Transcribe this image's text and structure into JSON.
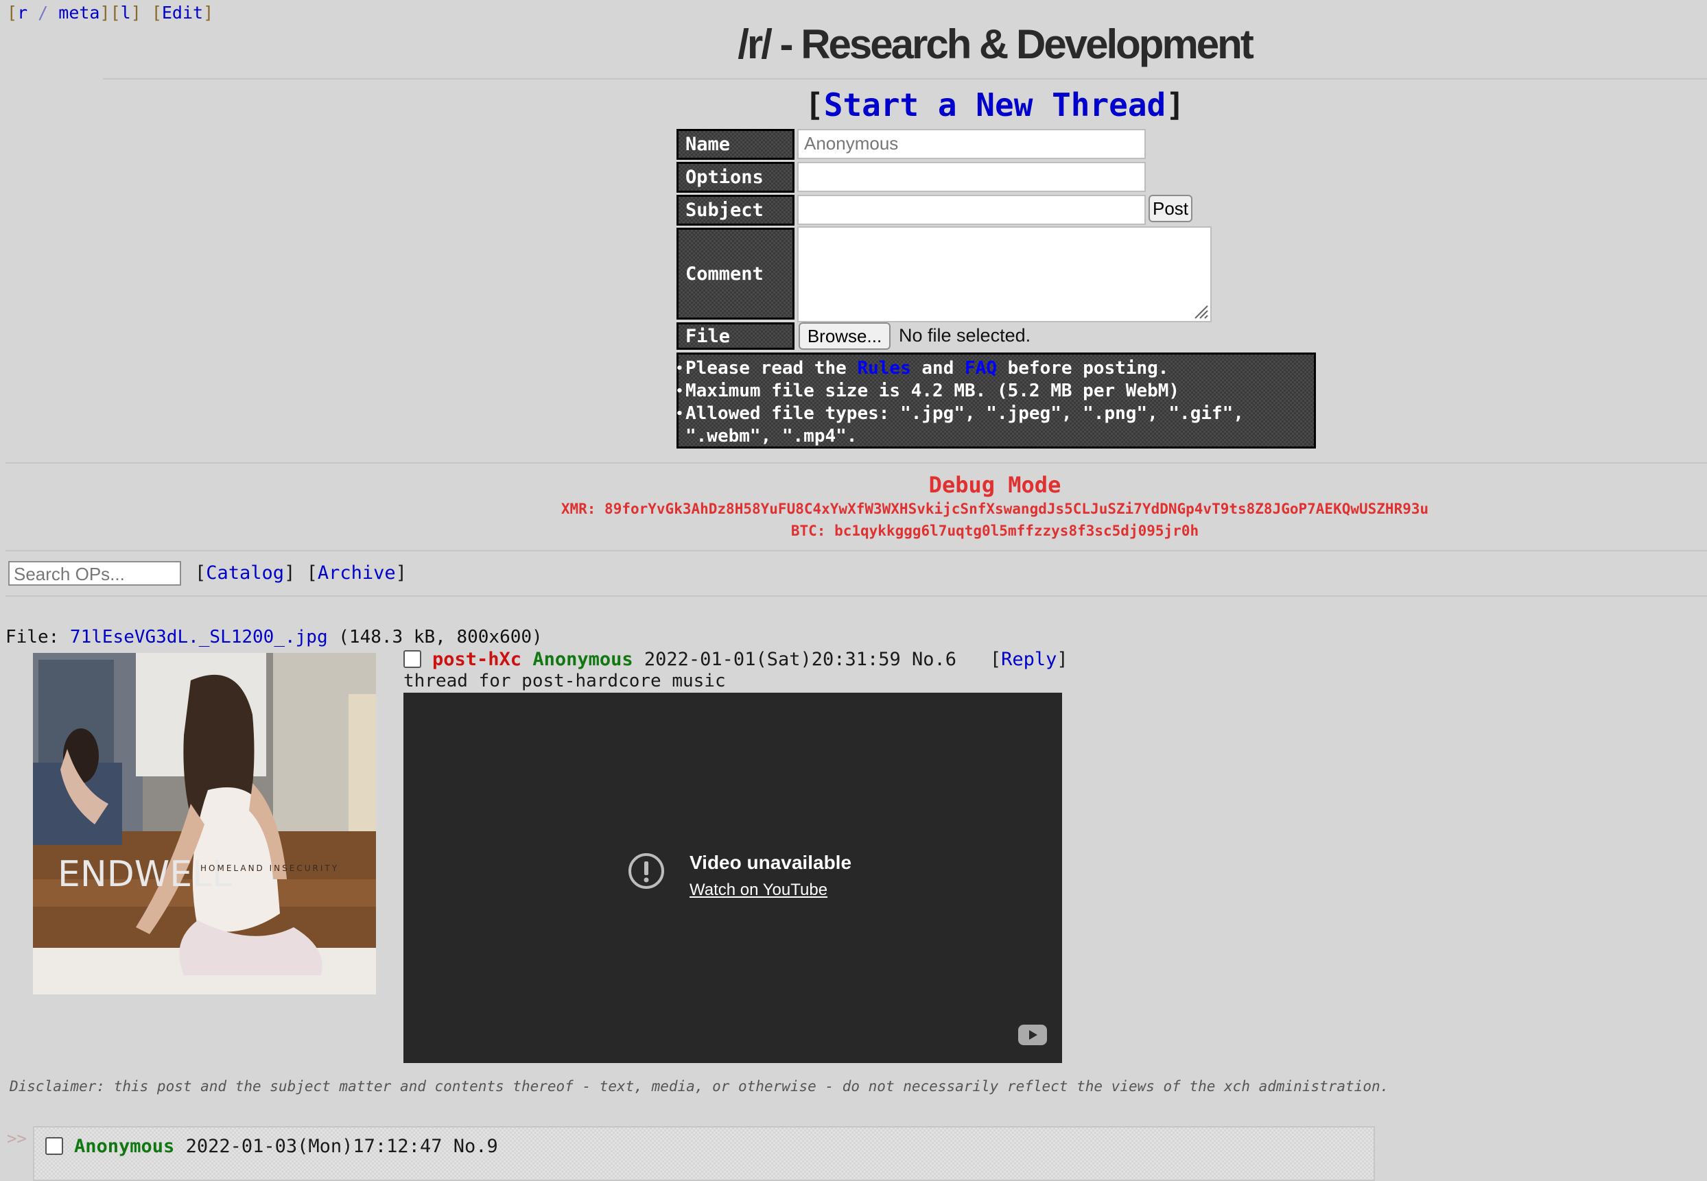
{
  "boardlist": {
    "open": "[",
    "board": "r",
    "sep": " / ",
    "meta": "meta",
    "close": "]",
    "l_open": "[",
    "l": "l",
    "l_close": "]",
    "edit_open": "[",
    "edit": "Edit",
    "edit_close": "]"
  },
  "board_title": "/r/ - Research & Development",
  "new_thread": {
    "open": "[",
    "label": "Start a New Thread",
    "close": "]"
  },
  "form": {
    "name_label": "Name",
    "name_placeholder": "Anonymous",
    "options_label": "Options",
    "subject_label": "Subject",
    "post_button": "Post",
    "comment_label": "Comment",
    "file_label": "File",
    "browse_button": "Browse...",
    "file_status": "No file selected."
  },
  "rules": {
    "line1_pre": "Please read the ",
    "rules_link": "Rules",
    "line1_mid": " and ",
    "faq_link": "FAQ",
    "line1_post": " before posting.",
    "line2": "Maximum file size is 4.2 MB. (5.2 MB per WebM)",
    "line3": "Allowed file types: \".jpg\", \".jpeg\", \".png\", \".gif\", \".webm\", \".mp4\"."
  },
  "debug": {
    "title": "Debug Mode",
    "xmr": "XMR: 89forYvGk3AhDz8H58YuFU8C4xYwXfW3WXHSvkijcSnfXswangdJs5CLJuSZi7YdDNGp4vT9ts8Z8JGoP7AEKQwUSZHR93u",
    "btc": "BTC: bc1qykkggg6l7uqtg0l5mffzzys8f3sc5dj095jr0h"
  },
  "search_placeholder": "Search OPs...",
  "nav": {
    "catalog_open": "[",
    "catalog": "Catalog",
    "catalog_close": "]",
    "archive_open": "[",
    "archive": "Archive",
    "archive_close": "]"
  },
  "op": {
    "file_prefix": "File: ",
    "file_name": "71lEseVG3dL._SL1200_.jpg",
    "file_meta": " (148.3 kB, 800x600)",
    "thumb_text": "ENDWELL",
    "thumb_subtext": "HOMELAND INSECURITY",
    "subject": "post-hXc",
    "name": "Anonymous",
    "date": "2022-01-01(Sat)20:31:59",
    "number": "No.6",
    "reply_open": "[",
    "reply_label": "Reply",
    "reply_close": "]",
    "body": "thread for post-hardcore music",
    "video_title": "Video unavailable",
    "video_link": "Watch on YouTube"
  },
  "disclaimer": "Disclaimer: this post and the subject matter and contents thereof - text, media, or otherwise - do not necessarily reflect the views of the xch administration.",
  "reply": {
    "arrows": ">>",
    "name": "Anonymous",
    "date": "2022-01-03(Mon)17:12:47",
    "number": "No.9"
  }
}
